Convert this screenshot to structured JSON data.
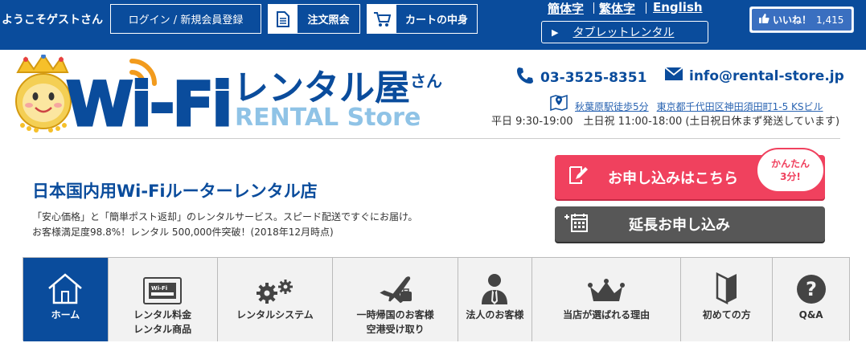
{
  "topbar": {
    "welcome": "ようこそゲストさん",
    "login_label": "ログイン / 新規会員登録",
    "order_label": "注文照会",
    "cart_label": "カートの中身",
    "lang_simplified": "簡体字",
    "lang_traditional": "繁体字",
    "lang_english": "English",
    "tablet_label": "タブレットレンタル",
    "like_label": "いいね！",
    "like_count": "1,415"
  },
  "header": {
    "logo_main": "Wi-Fi",
    "logo_jp": "レンタル屋",
    "logo_san": "さん",
    "logo_en": "RENTAL Store",
    "phone": "03-3525-8351",
    "email": "info@rental-store.jp",
    "station": "秋葉原駅徒歩5分",
    "address": "東京都千代田区神田須田町1-5 KSビル",
    "hours": "平日 9:30-19:00　土日祝 11:00-18:00 (土日祝日休まず発送しています)"
  },
  "intro": {
    "title": "日本国内用Wi-Fiルーターレンタル店",
    "desc_line1": "「安心価格」と「簡単ポスト返却」のレンタルサービス。スピード配送ですぐにお届け。",
    "desc_line2": "お客様満足度98.8%！レンタル 500,000件突破！(2018年12月時点)"
  },
  "cta": {
    "apply_label": "お申し込みはこちら",
    "badge_line1": "かんたん",
    "badge_line2": "3分!",
    "extend_label": "延長お申し込み"
  },
  "nav": {
    "items": [
      {
        "line1": "ホーム",
        "line2": ""
      },
      {
        "line1": "レンタル料金",
        "line2": "レンタル商品"
      },
      {
        "line1": "レンタルシステム",
        "line2": ""
      },
      {
        "line1": "一時帰国のお客様",
        "line2": "空港受け取り"
      },
      {
        "line1": "法人のお客様",
        "line2": ""
      },
      {
        "line1": "当店が選ばれる理由",
        "line2": ""
      },
      {
        "line1": "初めての方",
        "line2": ""
      },
      {
        "line1": "Q&A",
        "line2": ""
      }
    ]
  },
  "colors": {
    "brand_blue": "#0a4c9c",
    "apply_pink": "#f0415e",
    "extend_gray": "#575757",
    "logo_sky": "#8fc3e6",
    "logo_orange": "#f29b1d"
  }
}
